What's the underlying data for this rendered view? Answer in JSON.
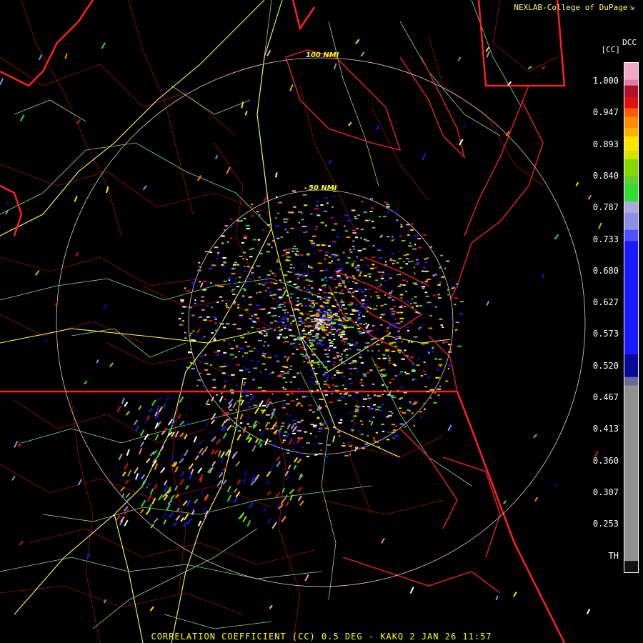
{
  "credit": {
    "text": "NEXLAB-College of DuPage",
    "logo_icon": "corner-arrow-icon"
  },
  "title": "CORRELATION COEFFICIENT (CC) 0.5 DEG - KAKQ 2 JAN 26 11:57",
  "range_rings": [
    "100 NMI",
    "50 NMI"
  ],
  "legend": {
    "product": "DCC",
    "unit": "[CC]",
    "ticks": [
      "1.000",
      "0.947",
      "0.893",
      "0.840",
      "0.787",
      "0.733",
      "0.680",
      "0.627",
      "0.573",
      "0.520",
      "0.467",
      "0.413",
      "0.360",
      "0.307",
      "0.253",
      "TH"
    ],
    "colors": {
      "pink_top": "#f3a7c9",
      "dark_red": "#b0102a",
      "red": "#e01010",
      "orange": "#ff8c00",
      "yellow": "#ffe600",
      "lime": "#88d800",
      "green": "#33dd33",
      "light_blue": "#8d8fe6",
      "blue": "#1a1aff",
      "navy": "#0a0a9a",
      "gray": "#909090",
      "th": "#111111"
    }
  },
  "map_colors": {
    "state_borders": "#ff2020",
    "coastline": "#d0201e",
    "county_lines": "#9a1010",
    "highways": "#ffff55",
    "roads": "#88dd88",
    "rings": "#f0c8c8"
  }
}
